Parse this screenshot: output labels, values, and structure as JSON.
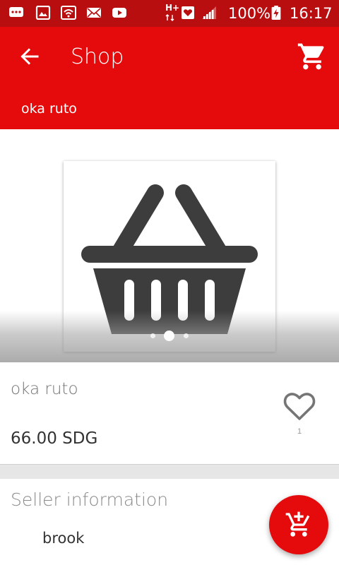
{
  "status_bar": {
    "battery_percent": "100%",
    "time": "16:17",
    "network": "H+",
    "icons": [
      "message-icon",
      "image-icon",
      "wifi-icon",
      "email-icon",
      "youtube-icon",
      "data-arrows-icon",
      "heart-notification-icon",
      "signal-icon",
      "battery-charging-icon"
    ]
  },
  "app_bar": {
    "title": "Shop",
    "subtitle": "oka ruto",
    "back_icon": "arrow-back-icon",
    "cart_icon": "shopping-cart-icon",
    "background_color": "#e50a0b"
  },
  "gallery": {
    "image_icon": "shopping-basket-icon",
    "page_count": 3,
    "active_index": 1
  },
  "product": {
    "name": "oka ruto",
    "price": "66.00 SDG",
    "favorite_icon": "heart-outline-icon",
    "favorite_count": "1"
  },
  "seller": {
    "title": "Seller information",
    "name": "brook"
  },
  "fab": {
    "icon": "add-to-cart-icon",
    "color": "#e50a0b"
  }
}
